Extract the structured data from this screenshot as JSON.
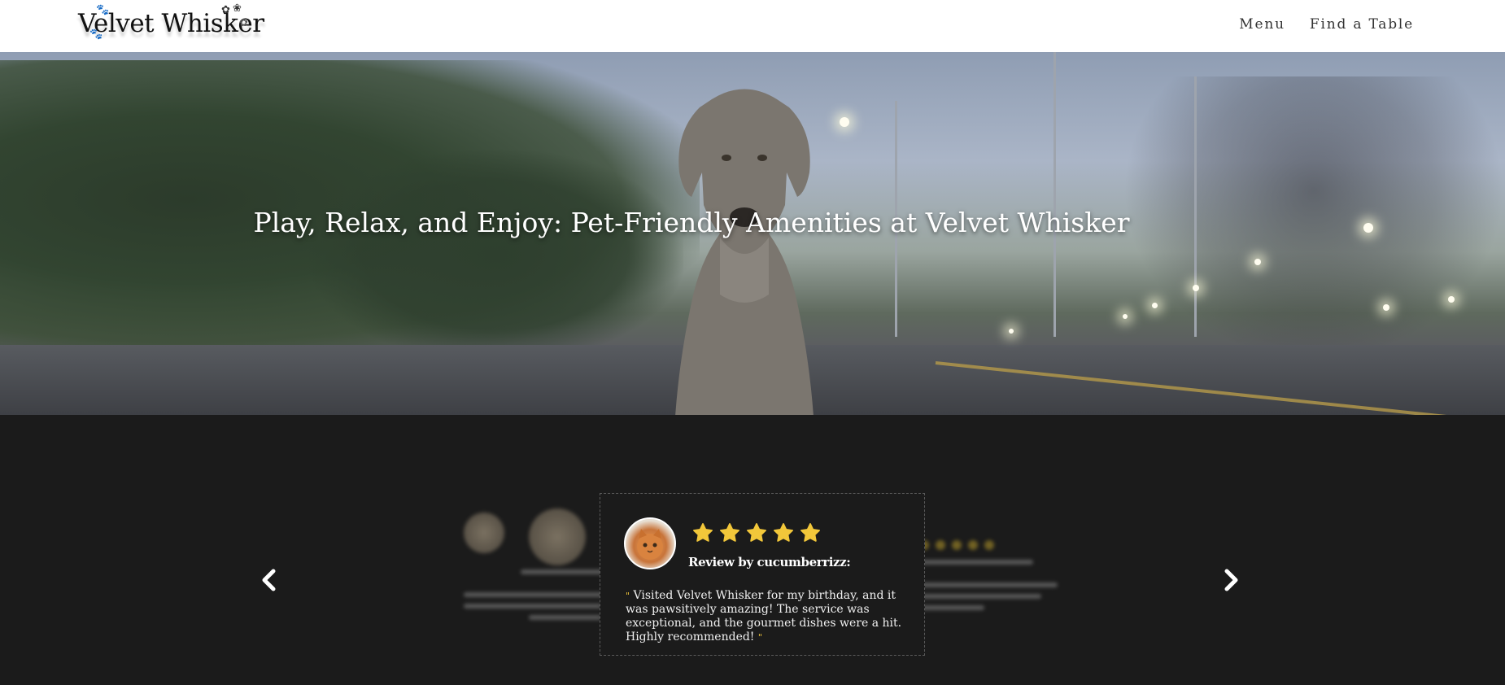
{
  "header": {
    "logo_text": "Velvet Whisker",
    "logo_icon": "paw-icon",
    "nav": [
      {
        "label": "Menu"
      },
      {
        "label": "Find a Table"
      }
    ]
  },
  "hero": {
    "title": "Play, Relax, and Enjoy: Pet-Friendly Amenities at Velvet Whisker"
  },
  "reviews": {
    "prev_icon": "chevron-left-icon",
    "next_icon": "chevron-right-icon",
    "active": {
      "reviewer": "Review by cucumberrizz:",
      "rating": 5,
      "rating_max": 5,
      "text": "Visited Velvet Whisker for my birthday, and it was pawsitively amazing! The service was exceptional, and the gourmet dishes were a hit. Highly recommended!",
      "open_quote": "\"",
      "close_quote": "\""
    }
  },
  "colors": {
    "accent_star": "#f2c73a",
    "background_dark": "#1b1b1b",
    "header_bg": "#ffffff"
  }
}
